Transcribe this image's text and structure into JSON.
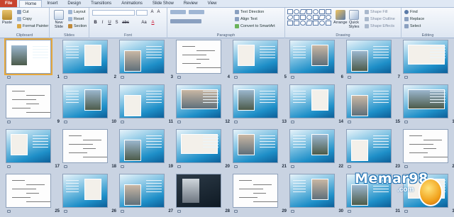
{
  "tabs": [
    "File",
    "Home",
    "Insert",
    "Design",
    "Transitions",
    "Animations",
    "Slide Show",
    "Review",
    "View"
  ],
  "active_tab": "Home",
  "ribbon": {
    "clipboard": {
      "label": "Clipboard",
      "paste": "Paste",
      "cut": "Cut",
      "copy": "Copy",
      "format_painter": "Format Painter"
    },
    "slides": {
      "label": "Slides",
      "new_slide": "New Slide",
      "layout": "Layout",
      "reset": "Reset",
      "section": "Section"
    },
    "font": {
      "label": "Font",
      "bold": "B",
      "italic": "I",
      "underline": "U",
      "shadow": "S",
      "strike": "abc",
      "aa": "Aa",
      "color": "A"
    },
    "paragraph": {
      "label": "Paragraph",
      "text_direction": "Text Direction",
      "align_text": "Align Text",
      "convert_smartart": "Convert to SmartArt"
    },
    "drawing": {
      "label": "Drawing",
      "arrange": "Arrange",
      "quick_styles": "Quick Styles",
      "shape_fill": "Shape Fill",
      "shape_outline": "Shape Outline",
      "shape_effects": "Shape Effects"
    },
    "editing": {
      "label": "Editing",
      "find": "Find",
      "replace": "Replace",
      "select": "Select"
    }
  },
  "slides": [
    {
      "n": "1",
      "style": "first"
    },
    {
      "n": "2",
      "style": "blue"
    },
    {
      "n": "3",
      "style": "blue"
    },
    {
      "n": "4",
      "style": "white"
    },
    {
      "n": "5",
      "style": "blue"
    },
    {
      "n": "6",
      "style": "blue"
    },
    {
      "n": "7",
      "style": "blue"
    },
    {
      "n": "8",
      "style": "blue"
    },
    {
      "n": "9",
      "style": "white"
    },
    {
      "n": "10",
      "style": "blue"
    },
    {
      "n": "11",
      "style": "blue"
    },
    {
      "n": "12",
      "style": "blue"
    },
    {
      "n": "13",
      "style": "blue"
    },
    {
      "n": "14",
      "style": "blue"
    },
    {
      "n": "15",
      "style": "blue"
    },
    {
      "n": "16",
      "style": "blue"
    },
    {
      "n": "17",
      "style": "blue"
    },
    {
      "n": "18",
      "style": "white"
    },
    {
      "n": "19",
      "style": "blue"
    },
    {
      "n": "20",
      "style": "blue"
    },
    {
      "n": "21",
      "style": "blue"
    },
    {
      "n": "22",
      "style": "blue"
    },
    {
      "n": "23",
      "style": "blue"
    },
    {
      "n": "24",
      "style": "white"
    },
    {
      "n": "25",
      "style": "white"
    },
    {
      "n": "26",
      "style": "blue"
    },
    {
      "n": "27",
      "style": "blue"
    },
    {
      "n": "28",
      "style": "dark"
    },
    {
      "n": "29",
      "style": "white"
    },
    {
      "n": "30",
      "style": "blue"
    },
    {
      "n": "31",
      "style": "blue"
    },
    {
      "n": "32",
      "style": "blue"
    }
  ],
  "watermark": {
    "text": "Memar98",
    "sub": ".com"
  },
  "colors": {
    "accent": "#1e8fc8",
    "file_tab": "#c8432f",
    "selection": "#e7a83a"
  }
}
